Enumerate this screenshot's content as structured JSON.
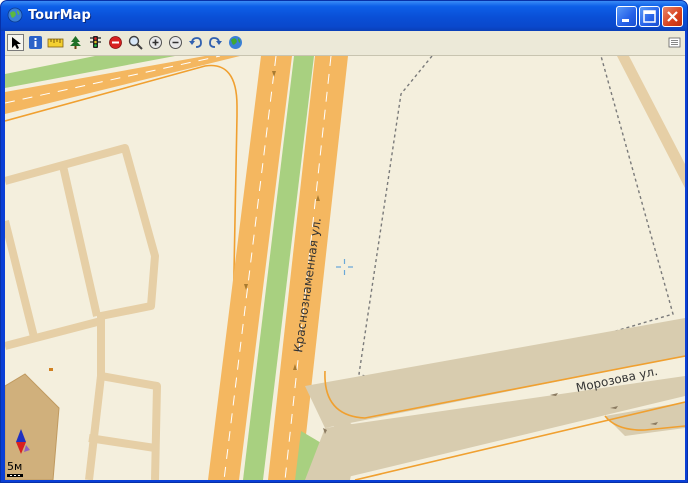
{
  "window": {
    "title": "TourMap",
    "app_icon": "globe-icon",
    "controls": [
      "minimize-icon",
      "maximize-icon",
      "close-icon"
    ]
  },
  "toolbar": {
    "tools": [
      {
        "name": "select-pointer",
        "icon": "arrow-pointer-icon",
        "pressed": true
      },
      {
        "name": "info",
        "icon": "info-icon"
      },
      {
        "name": "ruler",
        "icon": "ruler-icon"
      },
      {
        "name": "tree",
        "icon": "tree-icon"
      },
      {
        "name": "traffic-light",
        "icon": "traffic-light-icon"
      },
      {
        "name": "stop",
        "icon": "no-entry-icon"
      },
      {
        "name": "search",
        "icon": "magnifier-icon"
      },
      {
        "name": "zoom-in",
        "icon": "zoom-in-icon"
      },
      {
        "name": "zoom-out",
        "icon": "zoom-out-icon"
      },
      {
        "name": "undo",
        "icon": "undo-arrow-icon"
      },
      {
        "name": "redo",
        "icon": "redo-arrow-icon"
      },
      {
        "name": "globe",
        "icon": "globe-icon"
      },
      {
        "name": "menu",
        "icon": "list-menu-icon"
      }
    ]
  },
  "map": {
    "streets": [
      {
        "name": "Краснознаменная ул."
      },
      {
        "name": "Морозова ул."
      }
    ],
    "scale_label": "5м",
    "colors": {
      "background": "#f4efdd",
      "main_road": "#f4b760",
      "green_strip": "#a8d080",
      "footpath": "#e6cfa6",
      "secondary_road": "#d8ccaf",
      "building": "#d0b07c",
      "boundary": "#7a7a7a",
      "orange_line": "#f0a030"
    },
    "compass": "north-arrow-icon",
    "crosshair": "crosshair-icon"
  }
}
